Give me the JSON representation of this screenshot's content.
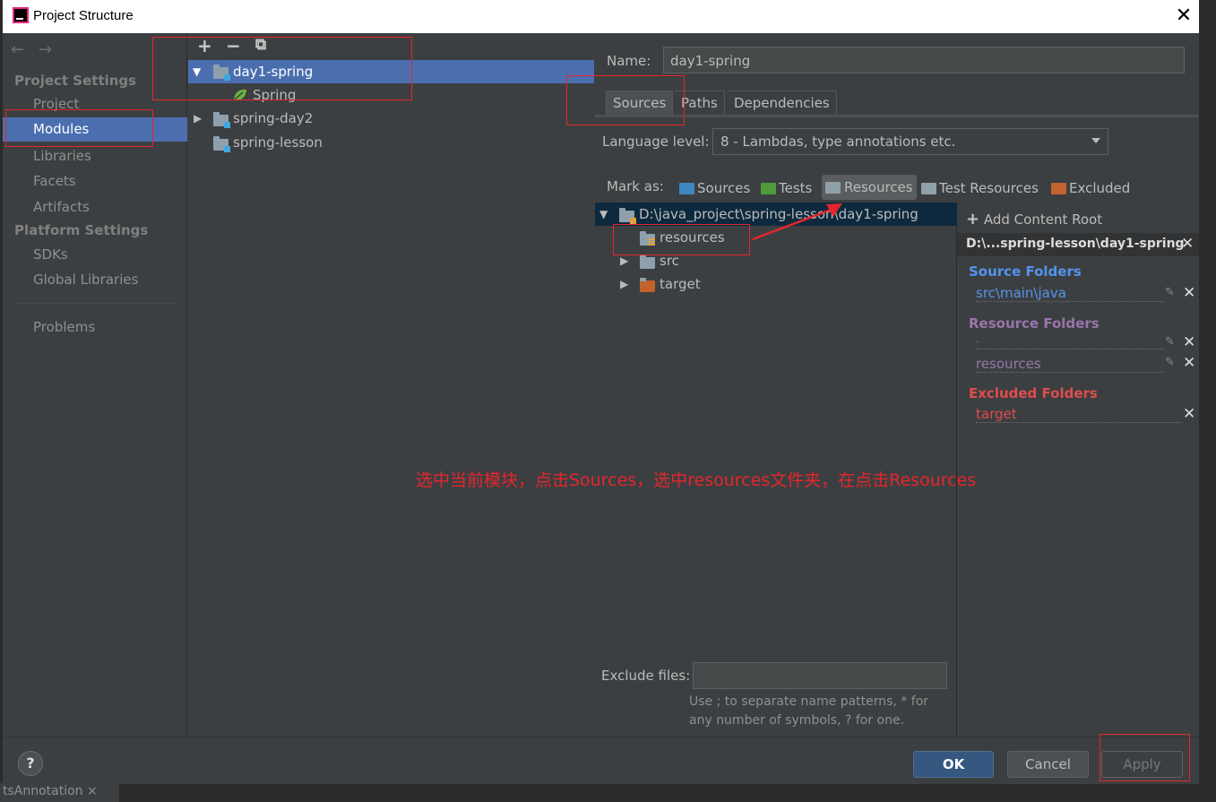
{
  "window": {
    "title": "Project Structure",
    "close_glyph": "✕"
  },
  "nav": {
    "project_settings_header": "Project Settings",
    "items_project": [
      "Project",
      "Modules",
      "Libraries",
      "Facets",
      "Artifacts"
    ],
    "platform_settings_header": "Platform Settings",
    "items_platform": [
      "SDKs",
      "Global Libraries"
    ],
    "problems": "Problems",
    "back_glyph": "←",
    "forward_glyph": "→"
  },
  "module_tree": {
    "add_glyph": "+",
    "remove_glyph": "−",
    "copy_glyph": "⧉",
    "items": [
      {
        "label": "day1-spring"
      },
      {
        "label": "Spring"
      },
      {
        "label": "spring-day2"
      },
      {
        "label": "spring-lesson"
      }
    ]
  },
  "module": {
    "name_label": "Name:",
    "name_value": "day1-spring",
    "tabs": [
      "Sources",
      "Paths",
      "Dependencies"
    ],
    "language_level_label": "Language level:",
    "language_level_value": "8 - Lambdas, type annotations etc.",
    "mark_as_label": "Mark as:",
    "mark_buttons": [
      "Sources",
      "Tests",
      "Resources",
      "Test Resources",
      "Excluded"
    ],
    "root_path": "D:\\java_project\\spring-lesson\\day1-spring",
    "root_children": [
      "resources",
      "src",
      "target"
    ],
    "exclude_files_label": "Exclude files:",
    "exclude_hint_1": "Use ; to separate name patterns, * for",
    "exclude_hint_2": "any number of symbols, ? for one."
  },
  "folders_panel": {
    "add_content_root": "Add Content Root",
    "root_title": "D:\\...spring-lesson\\day1-spring",
    "source_header": "Source Folders",
    "source_items": [
      "src\\main\\java"
    ],
    "resource_header": "Resource Folders",
    "resource_items": [
      ".",
      "resources"
    ],
    "excluded_header": "Excluded Folders",
    "excluded_items": [
      "target"
    ]
  },
  "buttons": {
    "ok": "OK",
    "cancel": "Cancel",
    "apply": "Apply",
    "help": "?"
  },
  "annotation": {
    "text": "选中当前模块，点击Sources，选中resources文件夹，在点击Resources"
  },
  "background": {
    "tab_text": "tsAnnotation ×"
  },
  "colors": {
    "selection": "#4b6eaf",
    "source_blue": "#5394ec",
    "resource_purple": "#9876aa",
    "excluded_red": "#e04c4c",
    "annotation_red": "#e4262d"
  }
}
